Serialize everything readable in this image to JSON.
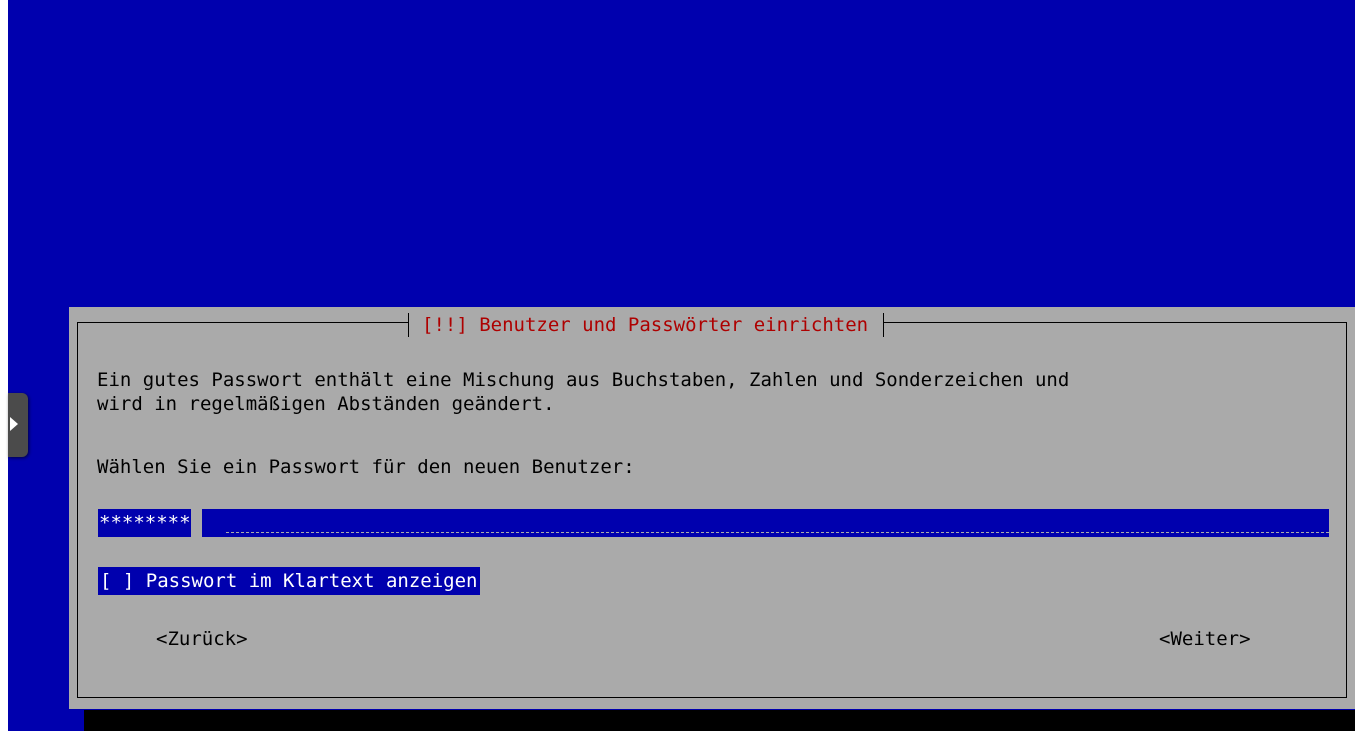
{
  "dialog": {
    "title": "[!!] Benutzer und Passwörter einrichten",
    "description_line1": "Ein gutes Passwort enthält eine Mischung aus Buchstaben, Zahlen und Sonderzeichen und",
    "description_line2": "wird in regelmäßigen Abständen geändert.",
    "prompt": "Wählen Sie ein Passwort für den neuen Benutzer:",
    "password_value": "********",
    "show_password_checkbox": "[ ] Passwort im Klartext anzeigen",
    "back_button": "<Zurück>",
    "next_button": "<Weiter>"
  },
  "side_panel": {
    "icon": "chevron-right-icon"
  },
  "colors": {
    "console_background": "#0000ae",
    "dialog_background": "#aaaaaa",
    "title_text": "#ae0000",
    "highlight": "#0000ae",
    "highlight_text": "#ffffff"
  }
}
